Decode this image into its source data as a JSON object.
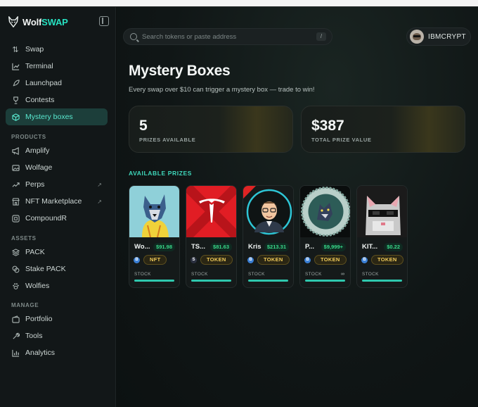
{
  "brand": {
    "name_main": "Wolf",
    "name_accent": "SWAP"
  },
  "sidebar": {
    "items": [
      {
        "label": "Swap",
        "icon": "swap-arrows-icon"
      },
      {
        "label": "Terminal",
        "icon": "chart-line-icon"
      },
      {
        "label": "Launchpad",
        "icon": "rocket-icon"
      },
      {
        "label": "Contests",
        "icon": "trophy-icon"
      },
      {
        "label": "Mystery boxes",
        "icon": "box-icon",
        "active": true
      }
    ],
    "products_label": "PRODUCTS",
    "products": [
      {
        "label": "Amplify",
        "icon": "megaphone-icon"
      },
      {
        "label": "Wolfage",
        "icon": "image-icon"
      },
      {
        "label": "Perps",
        "icon": "trend-up-icon",
        "external": true
      },
      {
        "label": "NFT Marketplace",
        "icon": "store-icon",
        "external": true
      },
      {
        "label": "CompoundR",
        "icon": "compound-icon"
      }
    ],
    "assets_label": "ASSETS",
    "assets": [
      {
        "label": "PACK",
        "icon": "layers-icon"
      },
      {
        "label": "Stake PACK",
        "icon": "coins-icon"
      },
      {
        "label": "Wolfies",
        "icon": "paw-icon"
      }
    ],
    "manage_label": "MANAGE",
    "manage": [
      {
        "label": "Portfolio",
        "icon": "wallet-icon"
      },
      {
        "label": "Tools",
        "icon": "wrench-icon"
      },
      {
        "label": "Analytics",
        "icon": "bar-chart-icon"
      }
    ],
    "external_glyph": "↗"
  },
  "search": {
    "placeholder": "Search tokens or paste address",
    "shortcut": "/"
  },
  "user": {
    "name": "IBMCRYPT"
  },
  "page": {
    "title": "Mystery Boxes",
    "subtitle": "Every swap over $10 can trigger a mystery box — trade to win!"
  },
  "stats": [
    {
      "value": "5",
      "label": "PRIZES AVAILABLE"
    },
    {
      "value": "$387",
      "label": "TOTAL PRIZE VALUE"
    }
  ],
  "prizes_label": "AVAILABLE PRIZES",
  "prizes": [
    {
      "name": "Wo...",
      "price": "$91.98",
      "chain": "B",
      "type": "NFT",
      "kind": "STOCK",
      "art": "wolf"
    },
    {
      "name": "TS...",
      "price": "$81.63",
      "chain": "S",
      "type": "TOKEN",
      "kind": "STOCK",
      "art": "tesla"
    },
    {
      "name": "Kris",
      "price": "$213.31",
      "chain": "B",
      "type": "TOKEN",
      "kind": "STOCK",
      "art": "person"
    },
    {
      "name": "P...",
      "price": "$9,999+",
      "chain": "B",
      "type": "TOKEN",
      "kind": "STOCK",
      "stock_value": "∞",
      "art": "coin"
    },
    {
      "name": "KIT...",
      "price": "$0.22",
      "chain": "B",
      "type": "TOKEN",
      "kind": "STOCK",
      "art": "cat"
    }
  ],
  "colors": {
    "accent": "#27e1c1",
    "active_bg": "#1c3e3a",
    "price_green": "#39d98a",
    "tag_gold": "#f2cc5a"
  }
}
